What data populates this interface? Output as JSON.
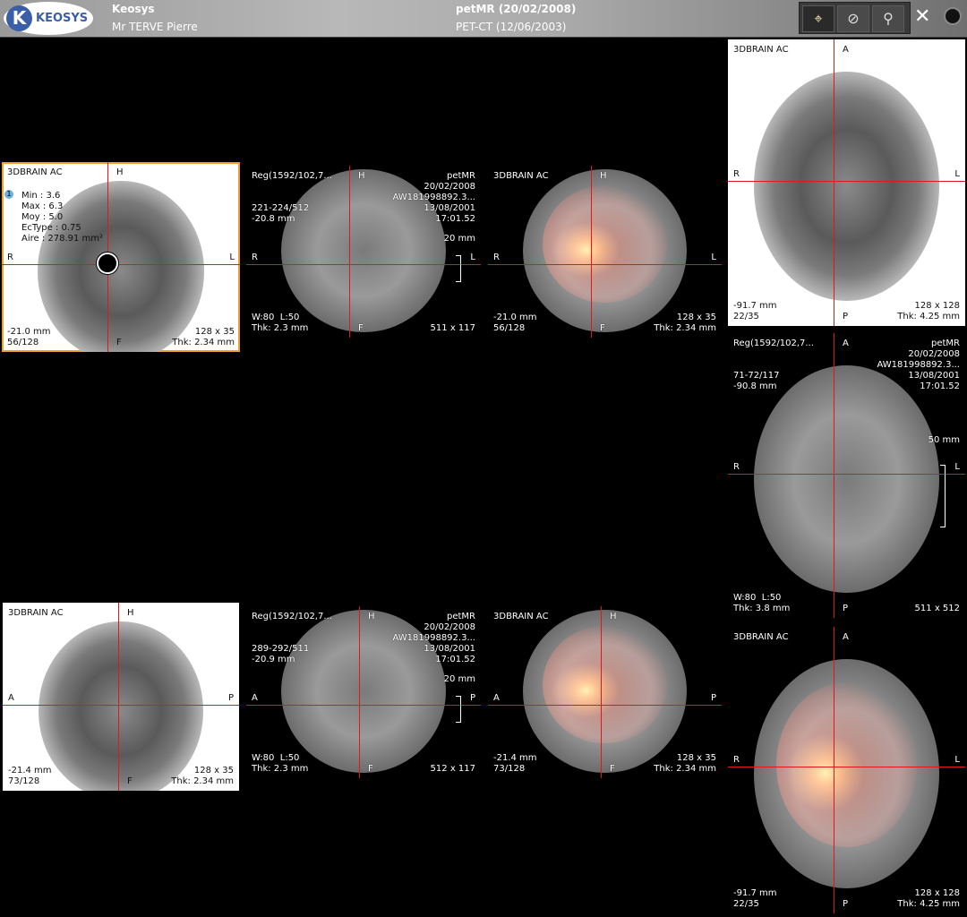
{
  "app": {
    "logo_letter": "K",
    "logo_text": "KEOSYS",
    "title": "Keosys",
    "user": "Mr TERVE Pierre"
  },
  "study": {
    "primary": "petMR (20/02/2008)",
    "secondary": "PET-CT (12/06/2003)"
  },
  "toolbar": {
    "tools": [
      {
        "name": "crosshair-tool",
        "glyph": "⌖"
      },
      {
        "name": "fusion-tool",
        "glyph": "⊘"
      },
      {
        "name": "zoom-pan-tool",
        "glyph": "⚲"
      }
    ],
    "close": "✕"
  },
  "colors": {
    "crosshair": "#e01818",
    "selected_border": "#f0a030",
    "brand": "#3b5ea8"
  },
  "roi": {
    "index": "1",
    "stats": "Min : 3.6\nMax : 6.3\nMoy : 5.0\nEcType : 0.75\nAire : 278.91 mm²"
  },
  "panels": [
    {
      "tl": "3DBRAIN AC",
      "tr": "",
      "ml": "",
      "bl": "-21.0 mm\n56/128",
      "br": "128 x 35\nThk: 2.34 mm",
      "top": "H",
      "bottom": "F",
      "left": "R",
      "right": "L",
      "scale": ""
    },
    {
      "tl": "Reg(1592/102,7...",
      "tr": "petMR\n20/02/2008\nAW181998892.3...\n13/08/2001\n17:01.52",
      "ml": "221-224/512\n-20.8 mm",
      "bl": "W:80  L:50\nThk: 2.3 mm",
      "br": "511 x 117",
      "top": "H",
      "bottom": "F",
      "left": "R",
      "right": "L",
      "scale": "20 mm"
    },
    {
      "tl": "3DBRAIN AC",
      "tr": "",
      "ml": "",
      "bl": "-21.0 mm\n56/128",
      "br": "128 x 35\nThk: 2.34 mm",
      "top": "H",
      "bottom": "F",
      "left": "R",
      "right": "L",
      "scale": ""
    },
    {
      "tl": "3DBRAIN AC",
      "tr": "",
      "ml": "",
      "bl": "-91.7 mm\n22/35",
      "br": "128 x 128\nThk: 4.25 mm",
      "top": "A",
      "bottom": "P",
      "left": "R",
      "right": "L",
      "scale": ""
    },
    {
      "tl": "Reg(1592/102,7...",
      "tr": "petMR\n20/02/2008\nAW181998892.3...\n13/08/2001\n17:01.52",
      "ml": "71-72/117\n-90.8 mm",
      "bl": "W:80  L:50\nThk: 3.8 mm",
      "br": "511 x 512",
      "top": "A",
      "bottom": "P",
      "left": "R",
      "right": "L",
      "scale": "50 mm"
    },
    {
      "tl": "3DBRAIN AC",
      "tr": "",
      "ml": "",
      "bl": "-91.7 mm\n22/35",
      "br": "128 x 128\nThk: 4.25 mm",
      "top": "A",
      "bottom": "P",
      "left": "R",
      "right": "L",
      "scale": ""
    },
    {
      "tl": "3DBRAIN AC",
      "tr": "",
      "ml": "",
      "bl": "-21.4 mm\n73/128",
      "br": "128 x 35\nThk: 2.34 mm",
      "top": "H",
      "bottom": "F",
      "left": "A",
      "right": "P",
      "scale": ""
    },
    {
      "tl": "Reg(1592/102,7...",
      "tr": "petMR\n20/02/2008\nAW181998892.3...\n13/08/2001\n17:01.52",
      "ml": "289-292/511\n-20.9 mm",
      "bl": "W:80  L:50\nThk: 2.3 mm",
      "br": "512 x 117",
      "top": "H",
      "bottom": "F",
      "left": "A",
      "right": "P",
      "scale": "20 mm"
    },
    {
      "tl": "3DBRAIN AC",
      "tr": "",
      "ml": "",
      "bl": "-21.4 mm\n73/128",
      "br": "128 x 35\nThk: 2.34 mm",
      "top": "H",
      "bottom": "F",
      "left": "A",
      "right": "P",
      "scale": ""
    }
  ]
}
